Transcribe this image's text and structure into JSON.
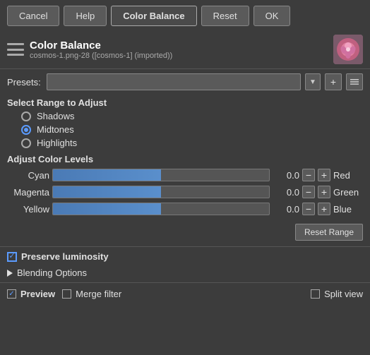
{
  "topbar": {
    "buttons": [
      "Cancel",
      "Help",
      "Color Balance",
      "Reset",
      "OK"
    ],
    "active": "Color Balance"
  },
  "header": {
    "title": "Color Balance",
    "subtitle": "cosmos-1.png-28 ([cosmos-1] (imported))",
    "icon_label": "color-balance-icon"
  },
  "presets": {
    "label": "Presets:",
    "value": "",
    "placeholder": "",
    "add_btn": "+",
    "menu_btn": "▼"
  },
  "range": {
    "label": "Select Range to Adjust",
    "options": [
      "Shadows",
      "Midtones",
      "Highlights"
    ],
    "selected": "Midtones"
  },
  "levels": {
    "label": "Adjust Color Levels",
    "sliders": [
      {
        "left_label": "Cyan",
        "value": "0.0",
        "right_label": "Red"
      },
      {
        "left_label": "Magenta",
        "value": "0.0",
        "right_label": "Green"
      },
      {
        "left_label": "Yellow",
        "value": "0.0",
        "right_label": "Blue"
      }
    ],
    "minus_btn": "−",
    "plus_btn": "+"
  },
  "reset_range_btn": "Reset Range",
  "preserve_luminosity": {
    "label": "Preserve luminosity",
    "checked": true
  },
  "blending_options": {
    "label": "Blending Options"
  },
  "bottom": {
    "preview": {
      "label": "Preview",
      "checked": true
    },
    "merge_filter": {
      "label": "Merge filter",
      "checked": false
    },
    "split_view": {
      "label": "Split view",
      "checked": false
    }
  }
}
